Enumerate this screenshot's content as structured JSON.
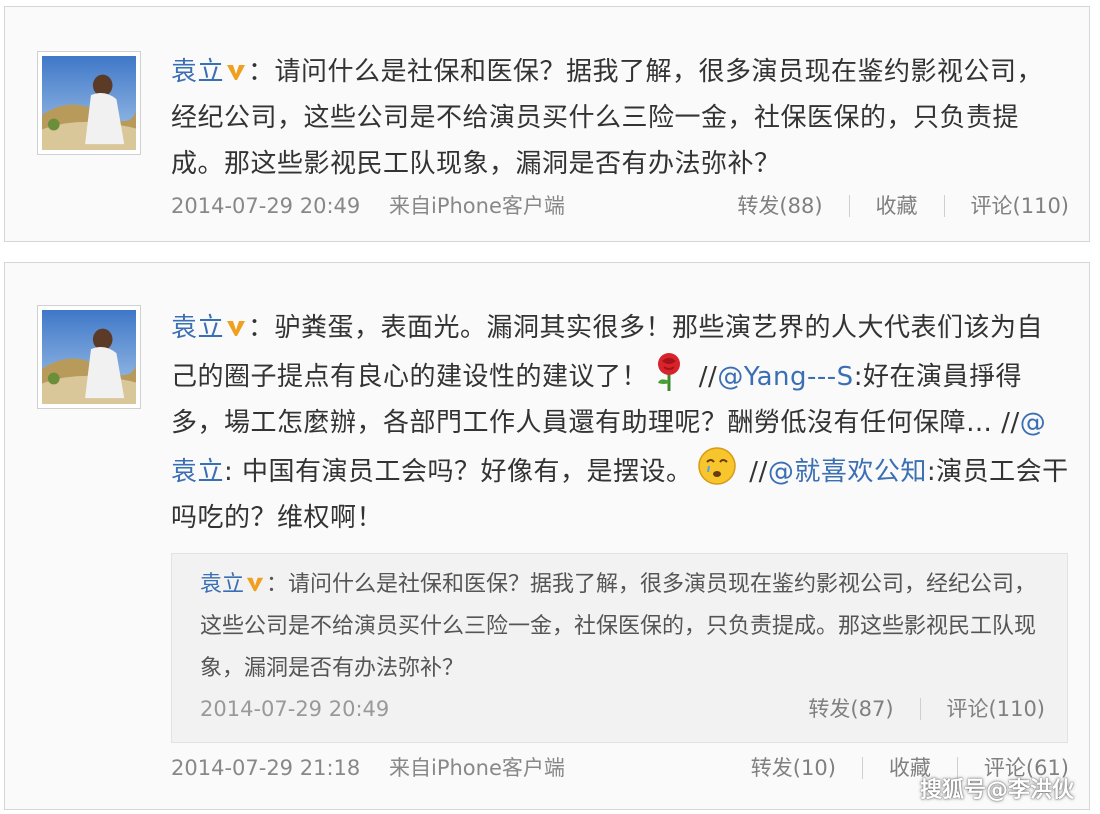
{
  "post1": {
    "author": "袁立",
    "colon": "：",
    "text": "请问什么是社保和医保？据我了解，很多演员现在鉴约影视公司，经纪公司，这些公司是不给演员买什么三险一金，社保医保的，只负责提成。那这些影视民工队现象，漏洞是否有办法弥补？",
    "time": "2014-07-29 20:49",
    "source": "来自iPhone客户端",
    "repost": "转发(88)",
    "favorite": "收藏",
    "comment": "评论(110)"
  },
  "post2": {
    "author": "袁立",
    "colon": "：",
    "text_a": "驴粪蛋，表面光。漏洞其实很多！那些演艺界的人大代表们该为自己的圈子提点有良心的建设性的建议了！",
    "sep1": " //",
    "mention1": "@Yang---S",
    "text_b": ":好在演員掙得多，場工怎麼辦，各部門工作人員還有助理呢？酬勞低沒有任何保障… //",
    "mention2": "@袁立",
    "text_c": ": 中国有演员工会吗？好像有，是摆设。",
    "sep2": " //",
    "mention3": "@就喜欢公知",
    "text_d": ":演员工会干吗吃的？维权啊！",
    "time": "2014-07-29 21:18",
    "source": "来自iPhone客户端",
    "repost": "转发(10)",
    "favorite": "收藏",
    "comment": "评论(61)"
  },
  "quote": {
    "author": "袁立",
    "colon": "：",
    "text": "请问什么是社保和医保？据我了解，很多演员现在鉴约影视公司，经纪公司，这些公司是不给演员买什么三险一金，社保医保的，只负责提成。那这些影视民工队现象，漏洞是否有办法弥补？",
    "time": "2014-07-29 20:49",
    "repost": "转发(87)",
    "comment": "评论(110)"
  },
  "watermark": "搜狐号@李洪伙",
  "colors": {
    "link": "#3b6fb3",
    "badge": "#f0a020",
    "meta": "#888888",
    "card_bg": "#fafafa",
    "quote_bg": "#f2f2f2"
  },
  "icons": {
    "verified": "verified-v-icon",
    "rose": "rose-emoji-icon",
    "face": "sad-face-emoji-icon"
  }
}
